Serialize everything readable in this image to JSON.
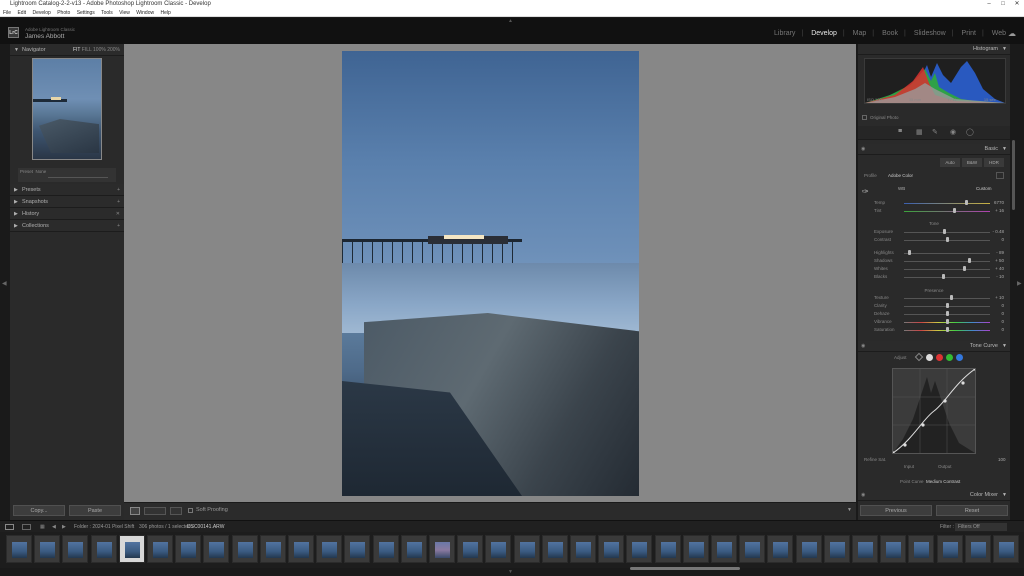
{
  "window": {
    "title": "Lightroom Catalog-2-2-v13 - Adobe Photoshop Lightroom Classic - Develop"
  },
  "menu": [
    "File",
    "Edit",
    "Develop",
    "Photo",
    "Settings",
    "Tools",
    "View",
    "Window",
    "Help"
  ],
  "identity": {
    "product": "Adobe Lightroom Classic",
    "user": "James Abbott",
    "logo": "LrC"
  },
  "modules": [
    "Library",
    "Develop",
    "Map",
    "Book",
    "Slideshow",
    "Print",
    "Web"
  ],
  "active_module": "Develop",
  "left_panel": {
    "navigator": {
      "title": "Navigator",
      "zoom_options": [
        "FIT",
        "FILL",
        "100%",
        "200%"
      ]
    },
    "history_readout": {
      "label": "Preset",
      "value": "None"
    },
    "sections": [
      "Presets",
      "Snapshots",
      "History",
      "Collections"
    ],
    "copy_label": "Copy...",
    "paste_label": "Paste"
  },
  "toolbar": {
    "soft_proofing": "Soft Proofing"
  },
  "right_panel": {
    "histogram": {
      "title": "Histogram",
      "readout": [
        "ISO 100",
        "35 mm",
        "f / 11",
        "15 sec"
      ],
      "original_photo": "Original Photo"
    },
    "basic": {
      "title": "Basic",
      "treatment_buttons": [
        "Auto",
        "B&W",
        "HDR"
      ],
      "profile_label": "Profile",
      "profile_value": "Adobe Color",
      "wb_label": "WB",
      "wb_value": "Custom",
      "sliders_wb": [
        {
          "label": "Temp",
          "value": "6770",
          "pos": 0.72
        },
        {
          "label": "Tint",
          "value": "+ 16",
          "pos": 0.58
        }
      ],
      "tone_label": "Tone",
      "sliders_tone": [
        {
          "label": "Exposure",
          "value": "- 0.48",
          "pos": 0.47
        },
        {
          "label": "Contrast",
          "value": "0",
          "pos": 0.5
        }
      ],
      "sliders_tone2": [
        {
          "label": "Highlights",
          "value": "- 89",
          "pos": 0.06
        },
        {
          "label": "Shadows",
          "value": "+ 50",
          "pos": 0.75
        },
        {
          "label": "Whites",
          "value": "+ 40",
          "pos": 0.7
        },
        {
          "label": "Blacks",
          "value": "- 10",
          "pos": 0.45
        }
      ],
      "presence_label": "Presence",
      "sliders_presence": [
        {
          "label": "Texture",
          "value": "+ 10",
          "pos": 0.55
        },
        {
          "label": "Clarity",
          "value": "0",
          "pos": 0.5
        },
        {
          "label": "Dehaze",
          "value": "0",
          "pos": 0.5
        },
        {
          "label": "Vibrance",
          "value": "0",
          "pos": 0.5
        },
        {
          "label": "Saturation",
          "value": "0",
          "pos": 0.5
        }
      ]
    },
    "tone_curve": {
      "title": "Tone Curve",
      "adjust_label": "Adjust",
      "refine_label": "Refine Sat.",
      "input_label": "Input",
      "output_label": "Output",
      "refine_value": "100",
      "point_curve_label": "Point Curve",
      "point_curve_value": "Medium Contrast"
    },
    "color_mixer": {
      "title": "Color Mixer"
    },
    "previous_label": "Previous",
    "reset_label": "Reset"
  },
  "filmstrip": {
    "folder": "Folder : 2024-01 Pixel Shift",
    "count": "306 photos / 1 selected /",
    "file": "DSC00141.ARW",
    "filter_label": "Filter :",
    "filter_value": "Filters Off"
  }
}
